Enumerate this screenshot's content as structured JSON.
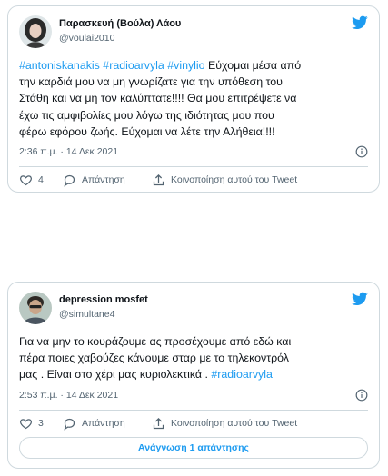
{
  "tweets": [
    {
      "name": "Παρασκευή (Βούλα) Λάου",
      "handle": "@voulai2010",
      "text_lines": [
        [
          {
            "t": "#antoniskanakis #radioarvyla #vinylio",
            "tag": true
          },
          {
            "t": "  Εύχομαι  μέσα από",
            "tag": false
          }
        ],
        [
          {
            "t": "την καρδιά μου να μη γνωρίζατε για την υπόθεση του",
            "tag": false
          }
        ],
        [
          {
            "t": "Στάθη και να μη τον καλύπτατε!!!! Θα μου επιτρέψετε να",
            "tag": false
          }
        ],
        [
          {
            "t": "έχω τις αμφιβολίες μου λόγω της ιδιότητας μου που",
            "tag": false
          }
        ],
        [
          {
            "t": "φέρω εφόρου ζωής. Εύχομαι να λέτε την Αλήθεια!!!!",
            "tag": false
          }
        ]
      ],
      "timestamp": "2:36 π.μ. · 14 Δεκ 2021",
      "like_count": "4",
      "reply_label": "Απάντηση",
      "share_label": "Κοινοποίηση αυτού του Tweet"
    },
    {
      "name": "depression mosfet",
      "handle": "@simultane4",
      "text_lines": [
        [
          {
            "t": "Για να μην το κουράζουμε ας προσέχουμε από εδώ και",
            "tag": false
          }
        ],
        [
          {
            "t": "πέρα ποιες χαβούζες κάνουμε σταρ με το τηλεκοντρόλ",
            "tag": false
          }
        ],
        [
          {
            "t": "μας . Είναι στο χέρι μας κυριολεκτικά . ",
            "tag": false
          },
          {
            "t": "#radioarvyla",
            "tag": true
          }
        ]
      ],
      "timestamp": "2:53 π.μ. · 14 Δεκ 2021",
      "like_count": "3",
      "reply_label": "Απάντηση",
      "share_label": "Κοινοποίηση αυτού του Tweet",
      "read_replies_label": "Ανάγνωση 1 απάντησης"
    }
  ],
  "colors": {
    "accent": "#1d9bf0",
    "secondary_text": "#536471",
    "border": "#cfd9de",
    "like_red": "#f91880"
  },
  "icons": [
    "twitter-bird-icon",
    "info-icon",
    "heart-icon",
    "reply-icon",
    "share-icon"
  ]
}
